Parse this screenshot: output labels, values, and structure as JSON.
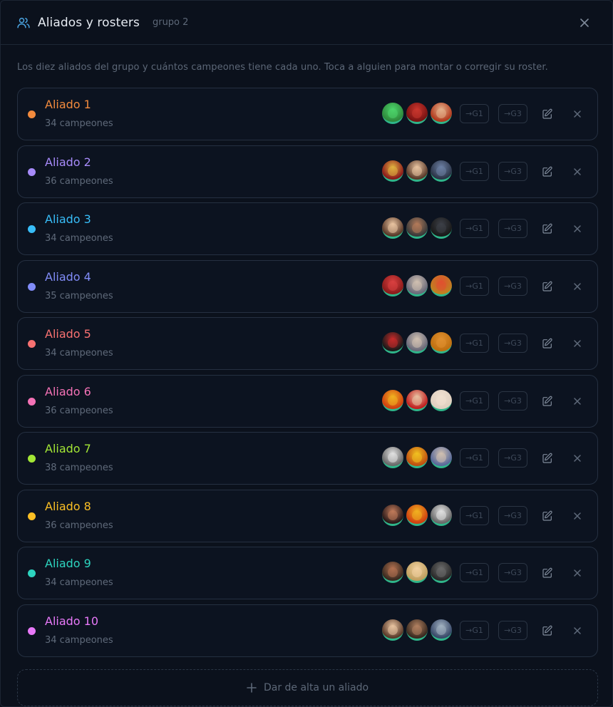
{
  "header": {
    "title": "Aliados y rosters",
    "subtitle": "grupo 2",
    "accent": "#4aa3df"
  },
  "description": "Los diez aliados del grupo y cuántos campeones tiene cada uno. Toca a alguien para montar o corregir su roster.",
  "move_labels": {
    "g1": "→G1",
    "g3": "→G3"
  },
  "allies": [
    {
      "name": "Aliado 1",
      "count": "34 campeones",
      "color": "#f28a3d",
      "avatars": [
        [
          "#2f8a3c",
          "#4cd36a"
        ],
        [
          "#7a1212",
          "#c9362e"
        ],
        [
          "#b23a1e",
          "#e3b08a"
        ]
      ]
    },
    {
      "name": "Aliado 2",
      "count": "36 campeones",
      "color": "#a78bfa",
      "avatars": [
        [
          "#8c1b1b",
          "#e0b040"
        ],
        [
          "#5a3a2a",
          "#e8c3a0"
        ],
        [
          "#2c3548",
          "#6c7fa3"
        ]
      ]
    },
    {
      "name": "Aliado 3",
      "count": "34 campeones",
      "color": "#38bdf8",
      "avatars": [
        [
          "#5a3a2a",
          "#e8c3a0"
        ],
        [
          "#3a3a3a",
          "#b27a5a"
        ],
        [
          "#1a1a1a",
          "#3c3f47"
        ]
      ]
    },
    {
      "name": "Aliado 4",
      "count": "35 campeones",
      "color": "#818cf8",
      "avatars": [
        [
          "#8c1b1b",
          "#d84040"
        ],
        [
          "#6a6a7a",
          "#d0c0b0"
        ],
        [
          "#c08020",
          "#e05030"
        ]
      ]
    },
    {
      "name": "Aliado 5",
      "count": "34 campeones",
      "color": "#f87171",
      "avatars": [
        [
          "#1a1a1a",
          "#c42a2a"
        ],
        [
          "#6a6a7a",
          "#d0c0b0"
        ],
        [
          "#c07010",
          "#e09030"
        ]
      ]
    },
    {
      "name": "Aliado 6",
      "count": "36 campeones",
      "color": "#f472b6",
      "avatars": [
        [
          "#d04010",
          "#f0b020"
        ],
        [
          "#c02020",
          "#e8c0a0"
        ],
        [
          "#e0d0c0",
          "#f0e0d0"
        ]
      ]
    },
    {
      "name": "Aliado 7",
      "count": "38 campeones",
      "color": "#a3e635",
      "avatars": [
        [
          "#6a6a6a",
          "#e0e0e0"
        ],
        [
          "#c05010",
          "#f0c020"
        ],
        [
          "#5a6a9a",
          "#d0c0b0"
        ]
      ]
    },
    {
      "name": "Aliado 8",
      "count": "36 campeones",
      "color": "#fbbf24",
      "avatars": [
        [
          "#2a1a1a",
          "#c07a5a"
        ],
        [
          "#d04010",
          "#f0b020"
        ],
        [
          "#6a6a6a",
          "#e0e0e0"
        ]
      ]
    },
    {
      "name": "Aliado 9",
      "count": "34 campeones",
      "color": "#2dd4bf",
      "avatars": [
        [
          "#3a2a20",
          "#b07050"
        ],
        [
          "#c0a060",
          "#f0d0a0"
        ],
        [
          "#2a2a2a",
          "#6a6a6a"
        ]
      ]
    },
    {
      "name": "Aliado 10",
      "count": "34 campeones",
      "color": "#e879f9",
      "avatars": [
        [
          "#5a3a2a",
          "#e8c3a0"
        ],
        [
          "#3a2a20",
          "#b08060"
        ],
        [
          "#3a4a6a",
          "#a0b0c0"
        ]
      ]
    }
  ],
  "add_button": "Dar de alta un aliado"
}
